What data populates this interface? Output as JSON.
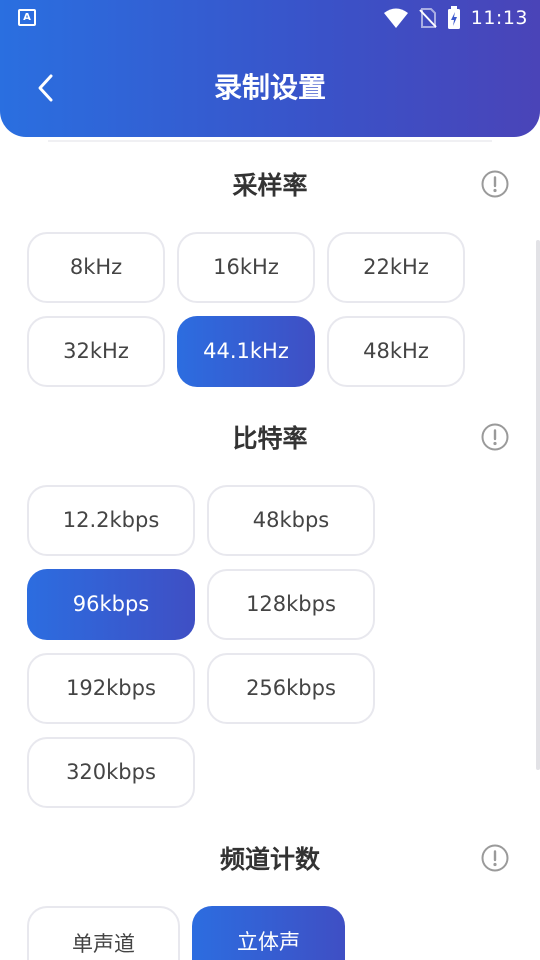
{
  "status_bar": {
    "app_icon_letter": "A",
    "time": "11:13"
  },
  "header": {
    "title": "录制设置"
  },
  "sample_rate": {
    "title": "采样率",
    "options": [
      "8kHz",
      "16kHz",
      "22kHz",
      "32kHz",
      "44.1kHz",
      "48kHz"
    ],
    "selected": "44.1kHz"
  },
  "bit_rate": {
    "title": "比特率",
    "options": [
      "12.2kbps",
      "48kbps",
      "96kbps",
      "128kbps",
      "192kbps",
      "256kbps",
      "320kbps"
    ],
    "selected": "96kbps"
  },
  "channels": {
    "title": "频道计数",
    "options": [
      "单声道",
      "立体声"
    ],
    "selected": "立体声"
  },
  "icons": {
    "back": "chevron-left-icon",
    "info": "info-icon",
    "wifi": "wifi-icon",
    "no_sim": "no-sim-icon",
    "battery": "battery-charging-icon"
  },
  "colors": {
    "accent_start": "#2a6fe0",
    "accent_end": "#4a44b8",
    "option_border": "#e8e8ee"
  }
}
